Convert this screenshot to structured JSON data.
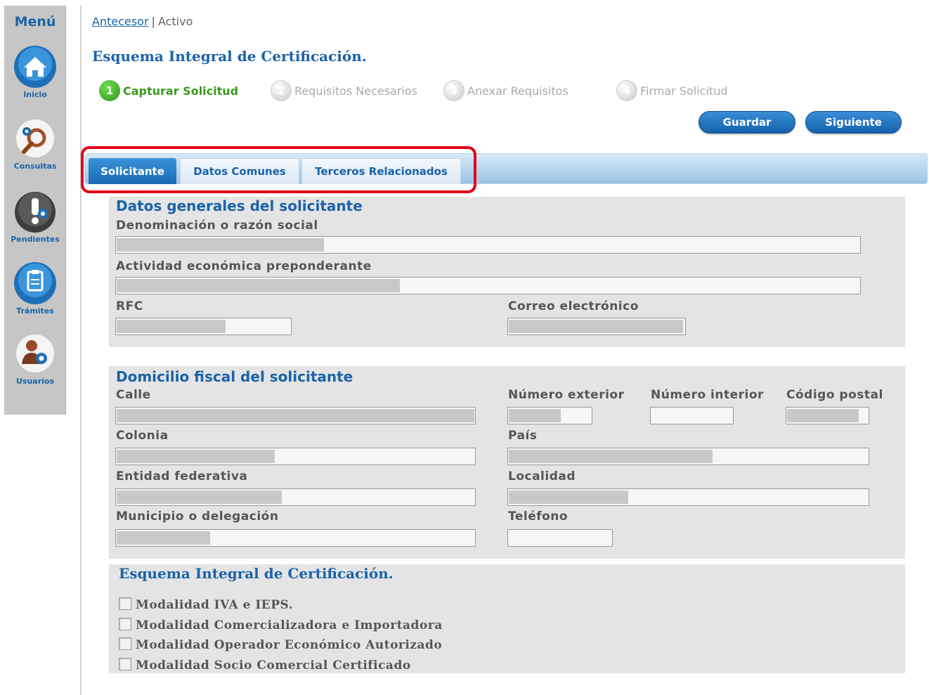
{
  "sidebar": {
    "title": "Menú",
    "items": [
      {
        "label": "Inicio"
      },
      {
        "label": "Consultas"
      },
      {
        "label": "Pendientes"
      },
      {
        "label": "Trámites"
      },
      {
        "label": "Usuarios"
      }
    ]
  },
  "breadcrumb": {
    "link": "Antecesor",
    "separator": "|",
    "current": "Activo"
  },
  "page_title": "Esquema Integral de Certificación.",
  "steps": [
    {
      "num": "1",
      "label": "Capturar Solicitud",
      "active": true
    },
    {
      "num": "2",
      "label": "Requisitos Necesarios",
      "active": false
    },
    {
      "num": "3",
      "label": "Anexar Requisitos",
      "active": false
    },
    {
      "num": "4",
      "label": "Firmar Solicitud",
      "active": false
    }
  ],
  "buttons": {
    "save": "Guardar",
    "next": "Siguiente"
  },
  "tabs": [
    {
      "label": "Solicitante",
      "active": true
    },
    {
      "label": "Datos Comunes",
      "active": false
    },
    {
      "label": "Terceros Relacionados",
      "active": false
    }
  ],
  "datos_generales": {
    "title": "Datos generales del solicitante",
    "denominacion_label": "Denominación o razón social",
    "actividad_label": "Actividad económica preponderante",
    "rfc_label": "RFC",
    "correo_label": "Correo electrónico"
  },
  "domicilio": {
    "title": "Domicilio fiscal del solicitante",
    "calle_label": "Calle",
    "num_ext_label": "Número exterior",
    "num_int_label": "Número interior",
    "cp_label": "Código postal",
    "colonia_label": "Colonia",
    "pais_label": "País",
    "entidad_label": "Entidad federativa",
    "localidad_label": "Localidad",
    "municipio_label": "Municipio o delegación",
    "telefono_label": "Teléfono"
  },
  "esquema": {
    "title": "Esquema Integral de Certificación.",
    "options": [
      "Modalidad IVA e IEPS.",
      "Modalidad Comercializadora e Importadora",
      "Modalidad Operador Económico Autorizado",
      "Modalidad Socio Comercial Certificado"
    ]
  },
  "colors": {
    "accent": "#1a63a8",
    "active_step": "#3a9a1e",
    "highlight": "#e3001b"
  }
}
